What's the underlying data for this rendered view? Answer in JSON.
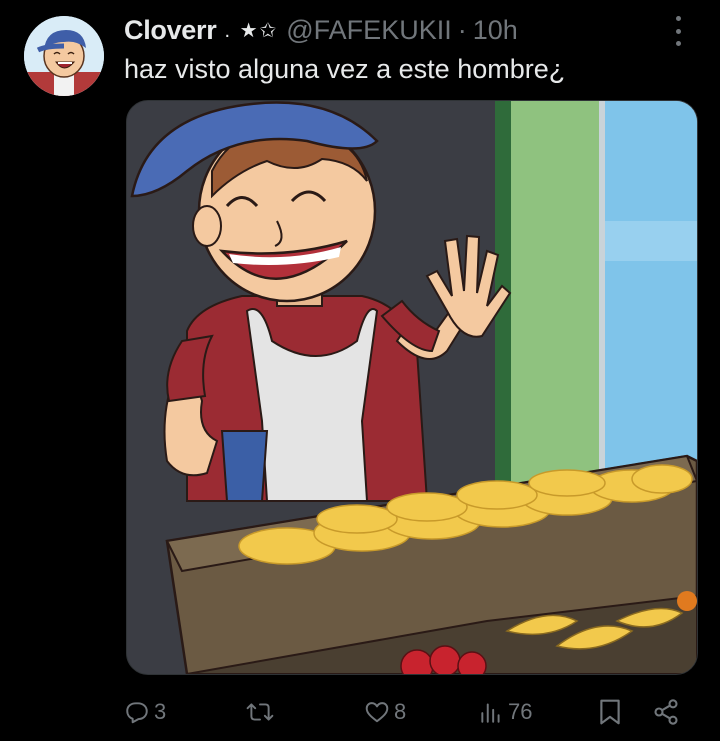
{
  "tweet": {
    "display_name": "Cloverr",
    "name_emoji": ". ★✩",
    "handle": "@FAFEKUKII",
    "separator": "·",
    "time": "10h",
    "text": "haz visto alguna vez a este hombre¿"
  },
  "actions": {
    "reply_count": "3",
    "like_count": "8",
    "views_count": "76"
  },
  "icons": {
    "reply": "reply-icon",
    "retweet": "retweet-icon",
    "like": "heart-icon",
    "views": "views-icon",
    "bookmark": "bookmark-icon",
    "share": "share-icon",
    "more": "more-icon"
  },
  "colors": {
    "background": "#000000",
    "text": "#e7e9ea",
    "muted": "#71767b"
  }
}
